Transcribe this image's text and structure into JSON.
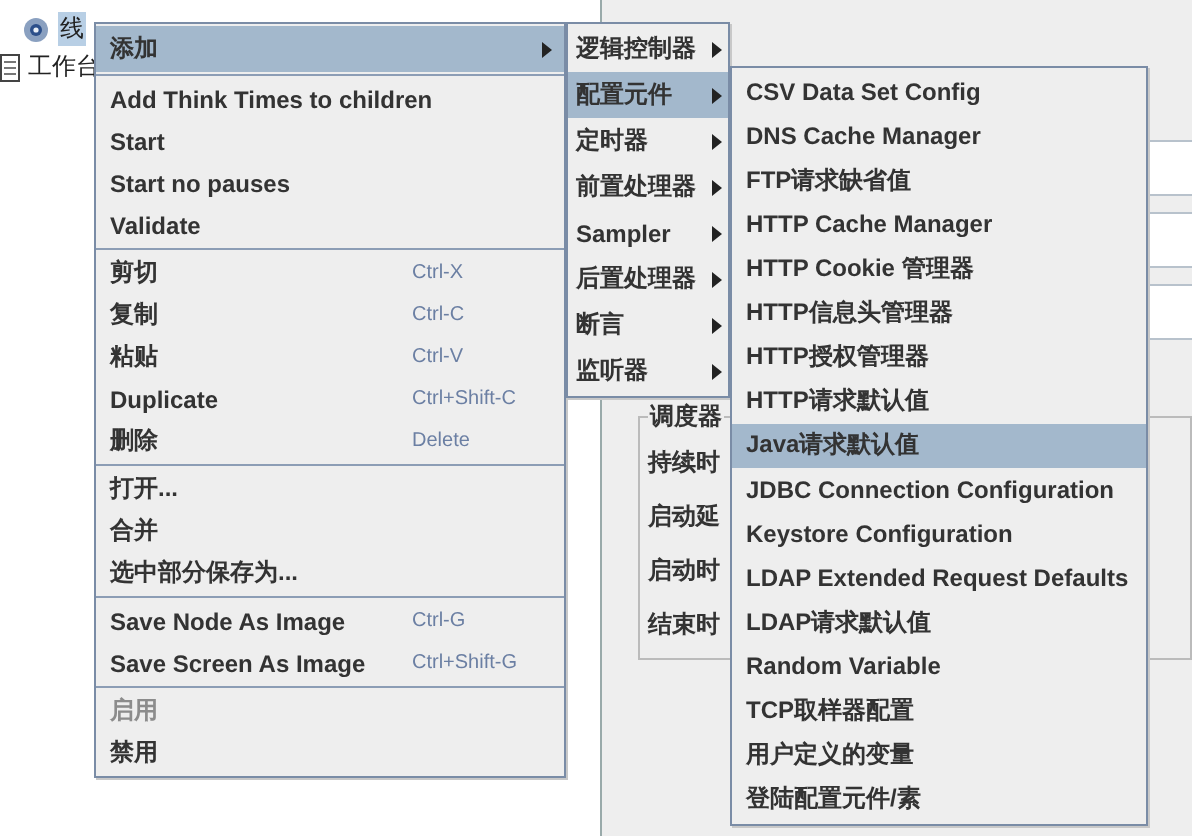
{
  "tree": {
    "items": [
      {
        "label": "线",
        "kind": "threads",
        "selected": true
      },
      {
        "label": "工作台",
        "kind": "bench",
        "selected": false
      }
    ]
  },
  "scheduler": {
    "title": "调度器",
    "labels": [
      "持续时",
      "启动延",
      "启动时",
      "结束时"
    ]
  },
  "context_menu": {
    "items": [
      {
        "kind": "item",
        "label": "添加",
        "submenu": true,
        "selected": true,
        "disabled": false
      },
      {
        "kind": "separator"
      },
      {
        "kind": "item",
        "label": "Add Think Times to children",
        "selected": false,
        "disabled": false
      },
      {
        "kind": "item",
        "label": "Start",
        "selected": false,
        "disabled": false
      },
      {
        "kind": "item",
        "label": "Start no pauses",
        "selected": false,
        "disabled": false
      },
      {
        "kind": "item",
        "label": "Validate",
        "selected": false,
        "disabled": false
      },
      {
        "kind": "separator"
      },
      {
        "kind": "item",
        "label": "剪切",
        "shortcut": "Ctrl-X",
        "selected": false,
        "disabled": false
      },
      {
        "kind": "item",
        "label": "复制",
        "shortcut": "Ctrl-C",
        "selected": false,
        "disabled": false
      },
      {
        "kind": "item",
        "label": "粘贴",
        "shortcut": "Ctrl-V",
        "selected": false,
        "disabled": false
      },
      {
        "kind": "item",
        "label": "Duplicate",
        "shortcut": "Ctrl+Shift-C",
        "selected": false,
        "disabled": false
      },
      {
        "kind": "item",
        "label": "删除",
        "shortcut": "Delete",
        "selected": false,
        "disabled": false
      },
      {
        "kind": "separator"
      },
      {
        "kind": "item",
        "label": "打开...",
        "selected": false,
        "disabled": false
      },
      {
        "kind": "item",
        "label": "合并",
        "selected": false,
        "disabled": false
      },
      {
        "kind": "item",
        "label": "选中部分保存为...",
        "selected": false,
        "disabled": false
      },
      {
        "kind": "separator"
      },
      {
        "kind": "item",
        "label": "Save Node As Image",
        "shortcut": "Ctrl-G",
        "selected": false,
        "disabled": false
      },
      {
        "kind": "item",
        "label": "Save Screen As Image",
        "shortcut": "Ctrl+Shift-G",
        "selected": false,
        "disabled": false
      },
      {
        "kind": "separator"
      },
      {
        "kind": "item",
        "label": "启用",
        "selected": false,
        "disabled": true
      },
      {
        "kind": "item",
        "label": "禁用",
        "selected": false,
        "disabled": false
      }
    ]
  },
  "add_submenu": {
    "items": [
      {
        "label": "逻辑控制器",
        "selected": false
      },
      {
        "label": "配置元件",
        "selected": true
      },
      {
        "label": "定时器",
        "selected": false
      },
      {
        "label": "前置处理器",
        "selected": false
      },
      {
        "label": "Sampler",
        "selected": false
      },
      {
        "label": "后置处理器",
        "selected": false
      },
      {
        "label": "断言",
        "selected": false
      },
      {
        "label": "监听器",
        "selected": false
      }
    ]
  },
  "config_submenu": {
    "items": [
      {
        "label": "CSV Data Set Config",
        "selected": false
      },
      {
        "label": "DNS Cache Manager",
        "selected": false
      },
      {
        "label": "FTP请求缺省值",
        "selected": false
      },
      {
        "label": "HTTP Cache Manager",
        "selected": false
      },
      {
        "label": "HTTP Cookie 管理器",
        "selected": false
      },
      {
        "label": "HTTP信息头管理器",
        "selected": false
      },
      {
        "label": "HTTP授权管理器",
        "selected": false
      },
      {
        "label": "HTTP请求默认值",
        "selected": false
      },
      {
        "label": "Java请求默认值",
        "selected": true
      },
      {
        "label": "JDBC Connection Configuration",
        "selected": false
      },
      {
        "label": "Keystore Configuration",
        "selected": false
      },
      {
        "label": "LDAP Extended Request Defaults",
        "selected": false
      },
      {
        "label": "LDAP请求默认值",
        "selected": false
      },
      {
        "label": "Random Variable",
        "selected": false
      },
      {
        "label": "TCP取样器配置",
        "selected": false
      },
      {
        "label": "用户定义的变量",
        "selected": false
      },
      {
        "label": "登陆配置元件/素",
        "selected": false
      }
    ]
  }
}
